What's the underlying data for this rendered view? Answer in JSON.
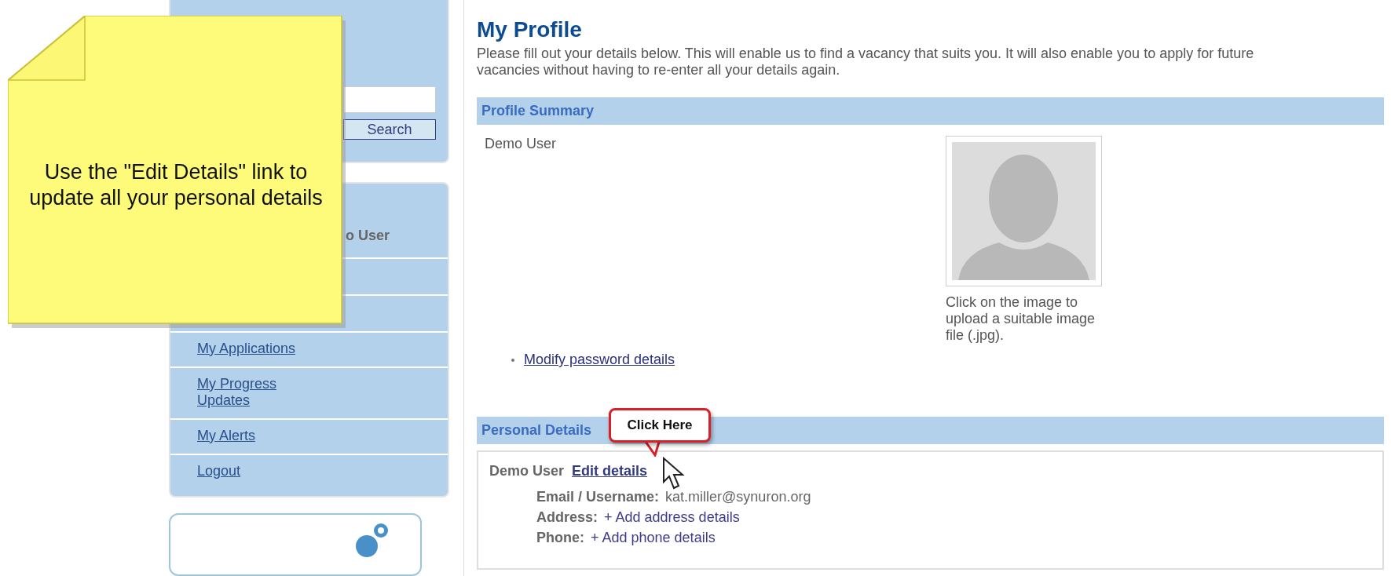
{
  "sticky_note": {
    "text": "Use the \"Edit Details\" link to update all your personal details"
  },
  "search": {
    "button": "Search"
  },
  "sidebar": {
    "user_fragment": "o User",
    "items": [
      {
        "label": "My Applications"
      },
      {
        "label": "My Progress Updates"
      },
      {
        "label": "My Alerts"
      },
      {
        "label": "Logout"
      }
    ]
  },
  "page": {
    "title": "My Profile",
    "intro": "Please fill out your details below. This will enable us to find a vacancy that suits you. It will also enable you to apply for future vacancies without having to re-enter all your details again."
  },
  "profile_summary": {
    "heading": "Profile Summary",
    "name": "Demo User",
    "photo_caption": "Click on the image to upload a suitable image file (.jpg).",
    "links": [
      "Modify password details"
    ]
  },
  "personal_details": {
    "heading": "Personal Details",
    "name": "Demo User",
    "edit_link": "Edit details",
    "fields": [
      {
        "label": "Email / Username:",
        "value": "kat.miller@synuron.org",
        "kind": "text"
      },
      {
        "label": "Address:",
        "value": "+ Add address details",
        "kind": "link"
      },
      {
        "label": "Phone:",
        "value": "+ Add phone details",
        "kind": "link"
      }
    ]
  },
  "callout": {
    "text": "Click Here"
  }
}
